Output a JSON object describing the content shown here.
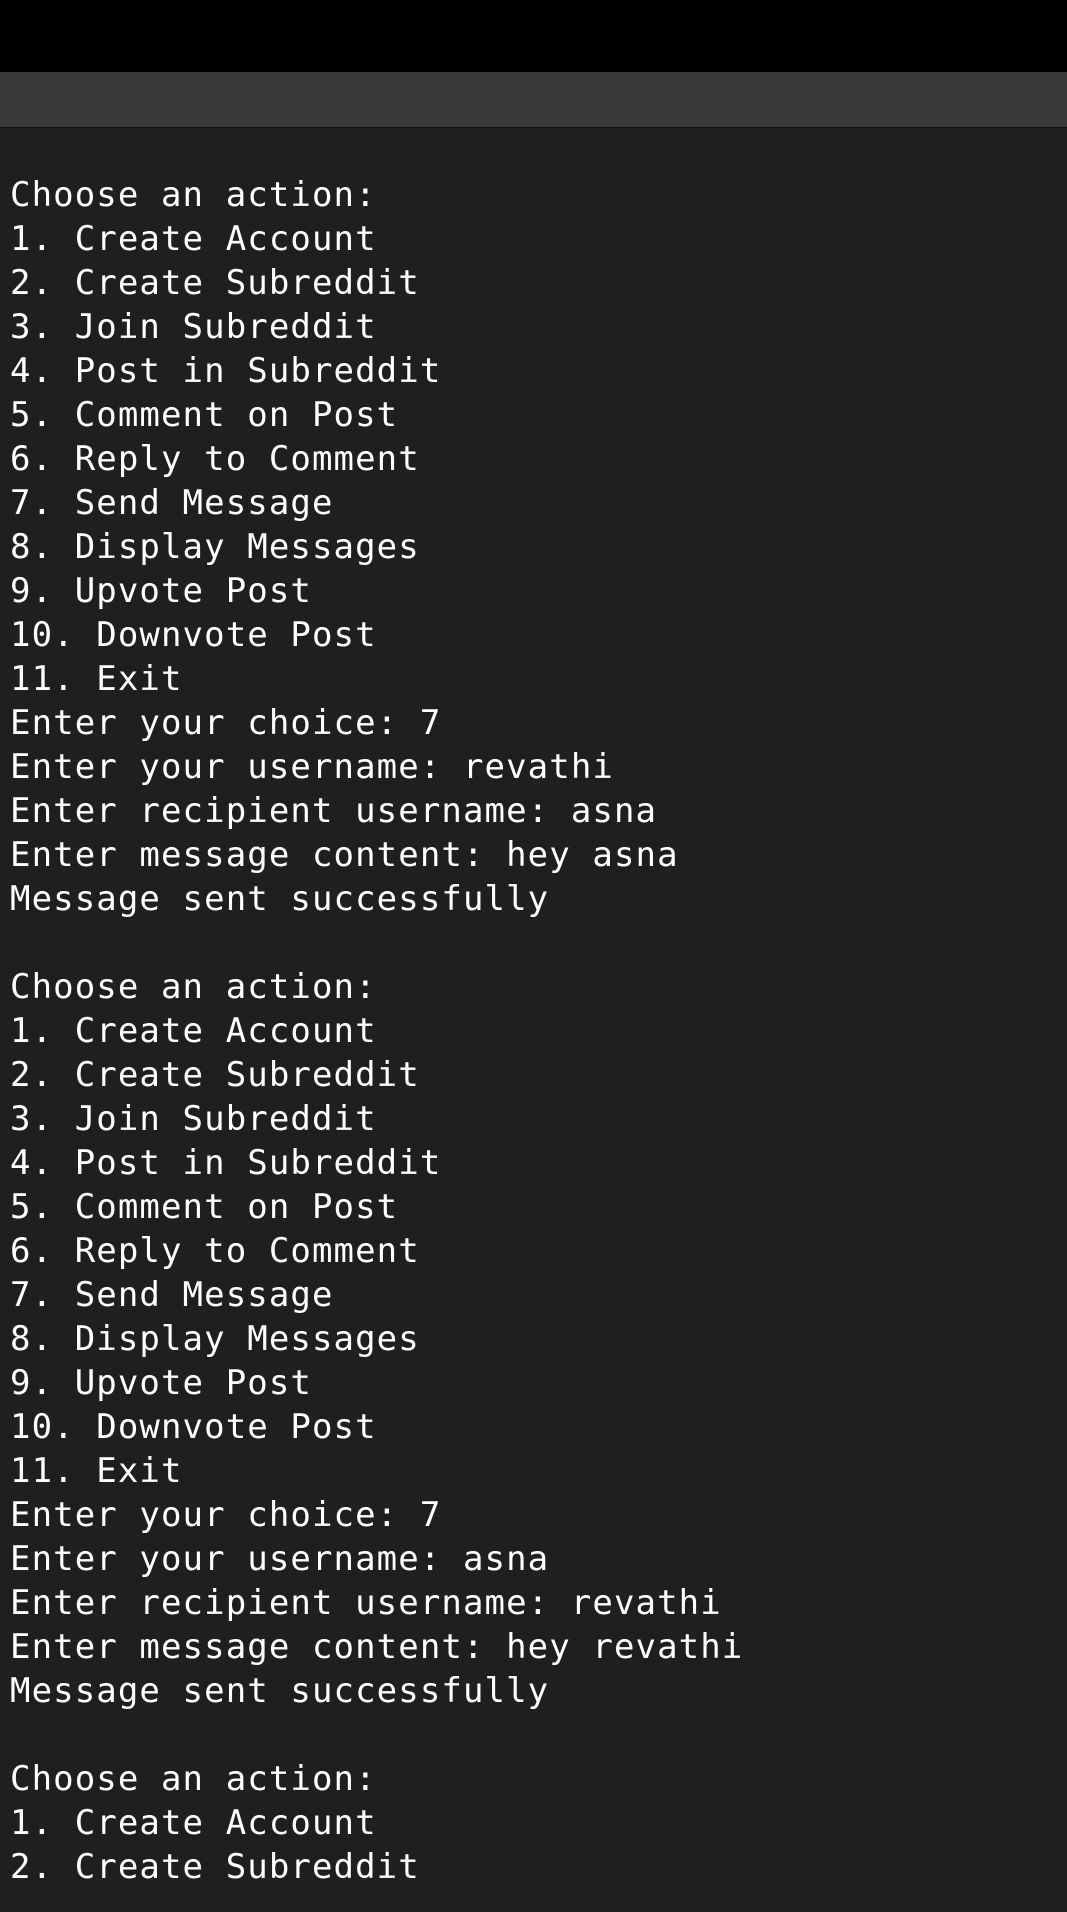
{
  "terminal": {
    "lines": [
      "Choose an action:",
      "1. Create Account",
      "2. Create Subreddit",
      "3. Join Subreddit",
      "4. Post in Subreddit",
      "5. Comment on Post",
      "6. Reply to Comment",
      "7. Send Message",
      "8. Display Messages",
      "9. Upvote Post",
      "10. Downvote Post",
      "11. Exit",
      "Enter your choice: 7",
      "Enter your username: revathi",
      "Enter recipient username: asna",
      "Enter message content: hey asna",
      "Message sent successfully",
      "",
      "Choose an action:",
      "1. Create Account",
      "2. Create Subreddit",
      "3. Join Subreddit",
      "4. Post in Subreddit",
      "5. Comment on Post",
      "6. Reply to Comment",
      "7. Send Message",
      "8. Display Messages",
      "9. Upvote Post",
      "10. Downvote Post",
      "11. Exit",
      "Enter your choice: 7",
      "Enter your username: asna",
      "Enter recipient username: revathi",
      "Enter message content: hey revathi",
      "Message sent successfully",
      "",
      "Choose an action:",
      "1. Create Account",
      "2. Create Subreddit"
    ]
  }
}
